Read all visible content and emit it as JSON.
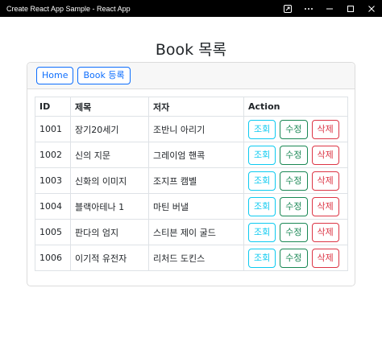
{
  "window": {
    "title": "Create React App Sample - React App"
  },
  "page": {
    "title": "Book 목록"
  },
  "nav": {
    "home_label": "Home",
    "register_label": "Book 등록"
  },
  "table": {
    "headers": {
      "id": "ID",
      "title": "제목",
      "author": "저자",
      "action": "Action"
    },
    "rows": [
      {
        "id": "1001",
        "title": "장기20세기",
        "author": "조반니 아리기"
      },
      {
        "id": "1002",
        "title": "신의 지문",
        "author": "그레이엄 핸콕"
      },
      {
        "id": "1003",
        "title": "신화의 이미지",
        "author": "조지프 캠벨"
      },
      {
        "id": "1004",
        "title": "블랙아테나 1",
        "author": "마틴 버낼"
      },
      {
        "id": "1005",
        "title": "판다의 엄지",
        "author": "스티븐 제이 굴드"
      },
      {
        "id": "1006",
        "title": "이기적 유전자",
        "author": "리처드 도킨스"
      }
    ],
    "actions": {
      "view": "조회",
      "edit": "수정",
      "delete": "삭제"
    }
  },
  "colors": {
    "primary": "#0d6efd",
    "info": "#0dcaf0",
    "success": "#198754",
    "danger": "#dc3545"
  }
}
